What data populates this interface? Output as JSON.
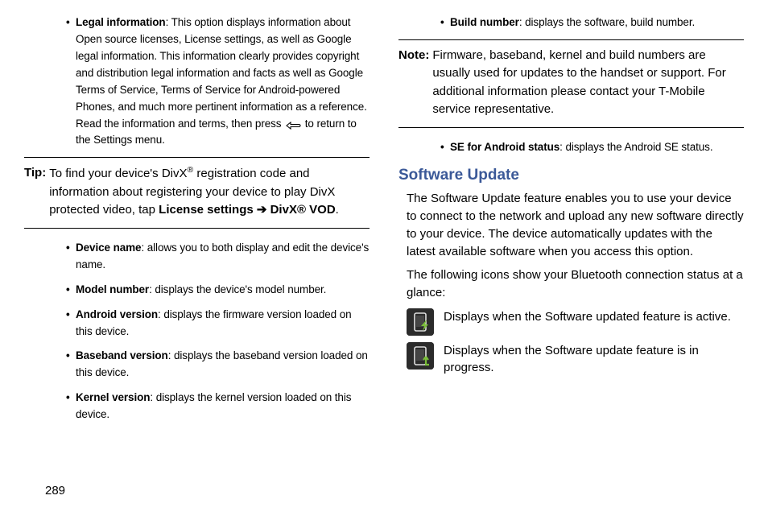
{
  "left": {
    "legal": {
      "label": "Legal information",
      "text1": ": This option displays information about Open source licenses, License settings, as well as Google legal information. This information clearly provides copyright and distribution legal information and facts as well as Google Terms of Service, Terms of Service for Android-powered Phones, and much more pertinent information as a reference.",
      "text2a": "Read the information and terms, then press ",
      "text2b": " to return to the Settings menu."
    },
    "tip": {
      "label": "Tip:",
      "body1": "To find your device's DivX",
      "body2": " registration code and information about registering your device to play DivX protected video, tap ",
      "body3": "License settings ➔ DivX® VOD",
      "body4": "."
    },
    "items": {
      "deviceName": {
        "label": "Device name",
        "text": ": allows you to both display and edit the device's name."
      },
      "modelNumber": {
        "label": "Model number",
        "text": ": displays the device's model number."
      },
      "androidVersion": {
        "label": "Android version",
        "text": ": displays the firmware version loaded on this device."
      },
      "basebandVersion": {
        "label": "Baseband version",
        "text": ": displays the baseband version loaded on this device."
      },
      "kernelVersion": {
        "label": "Kernel version",
        "text": ": displays the kernel version loaded on this device."
      }
    }
  },
  "right": {
    "buildNumber": {
      "label": "Build number",
      "text": ": displays the software, build number."
    },
    "note": {
      "label": "Note:",
      "body": "Firmware, baseband, kernel and build numbers are usually used for updates to the handset or support. For additional information please contact your T-Mobile service representative."
    },
    "seAndroid": {
      "label": "SE for Android status",
      "text": ": displays the Android SE status."
    },
    "heading": "Software Update",
    "para1": "The Software Update feature enables you to use your device to connect to the network and upload any new software directly to your device. The device automatically updates with the latest available software when you access this option.",
    "para2": "The following icons show your Bluetooth connection status at a glance:",
    "iconRow1": "Displays when the Software updated feature is active.",
    "iconRow2": "Displays when the Software update feature is in progress."
  },
  "pageNumber": "289",
  "reg": "®"
}
